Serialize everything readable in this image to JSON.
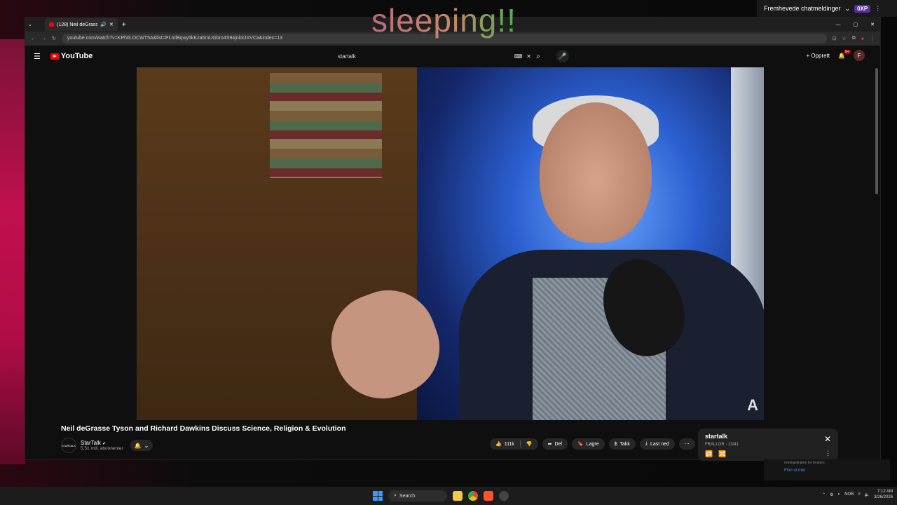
{
  "overlay_text": "sleeping!!",
  "top_bar": {
    "chat_label": "Fremhevede chatmeldinger",
    "badge": "0XP"
  },
  "browser": {
    "tab_title": "(128) Neil deGrasse Tyson",
    "url": "youtube.com/watch?v=KPh0LOCWT5A&list=PLmlBqwy5kKza5mUGbro4S94jnlotJXVCa&index=13"
  },
  "youtube": {
    "logo_text": "YouTube",
    "search_query": "startalk",
    "create_label": "Opprett",
    "notif_count": "9+",
    "avatar_letter": "F"
  },
  "video": {
    "title": "Neil deGrasse Tyson and Richard Dawkins Discuss Science, Religion & Evolution",
    "channel_name": "StarTalk",
    "subscribers": "5,51 mill. abonnenter",
    "channel_avatar_text": "STARTALK",
    "likes": "111k",
    "share_label": "Del",
    "save_label": "Lagre",
    "thanks_label": "Takk",
    "download_label": "Last ned"
  },
  "playlist": {
    "title": "startalk",
    "subtitle": "FRALLOR · 13/41"
  },
  "notification": {
    "text": "retningslinjene for brukere.",
    "link": "Finn ut mer"
  },
  "taskbar": {
    "search_label": "Search",
    "language": "NOB",
    "time": "7:12 AM",
    "date": "3/26/2026"
  }
}
